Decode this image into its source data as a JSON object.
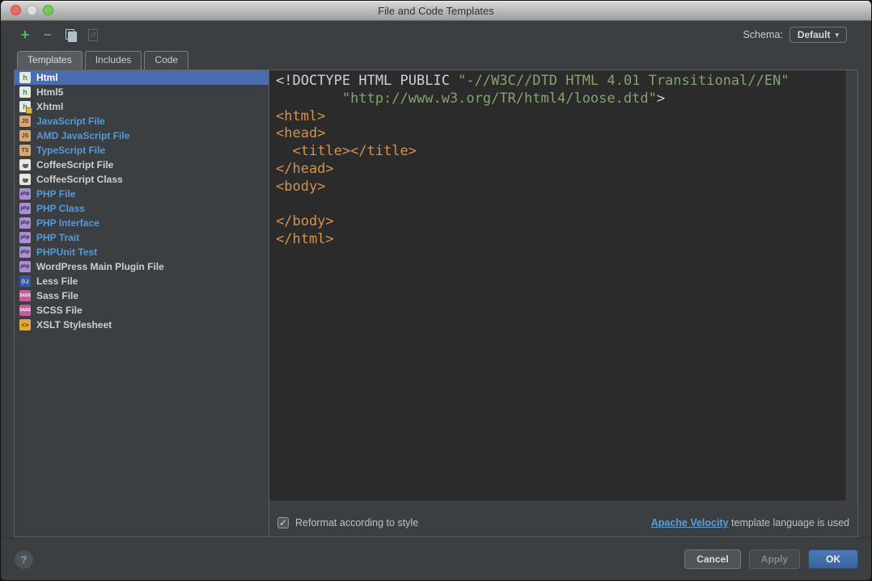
{
  "window": {
    "title": "File and Code Templates"
  },
  "titlebar_icons": {
    "close": "close-button",
    "minimize": "minimize-button",
    "zoom": "zoom-button"
  },
  "toolbar": {
    "add_glyph": "+",
    "remove_glyph": "−",
    "revert_glyph": "↺",
    "schema_label": "Schema:",
    "schema_value": "Default",
    "schema_caret": "▾"
  },
  "tabs": [
    {
      "label": "Templates",
      "selected": true
    },
    {
      "label": "Includes",
      "selected": false
    },
    {
      "label": "Code",
      "selected": false
    }
  ],
  "sidebar": {
    "items": [
      {
        "label": "Html",
        "icon": "html",
        "color": "plain",
        "selected": true
      },
      {
        "label": "Html5",
        "icon": "html",
        "color": "plain",
        "selected": false
      },
      {
        "label": "Xhtml",
        "icon": "xhtml",
        "color": "plain",
        "selected": false
      },
      {
        "label": "JavaScript File",
        "icon": "js",
        "color": "blue",
        "selected": false
      },
      {
        "label": "AMD JavaScript File",
        "icon": "js",
        "color": "blue",
        "selected": false
      },
      {
        "label": "TypeScript File",
        "icon": "ts",
        "color": "blue",
        "selected": false
      },
      {
        "label": "CoffeeScript File",
        "icon": "coffee",
        "color": "plain",
        "selected": false
      },
      {
        "label": "CoffeeScript Class",
        "icon": "coffee",
        "color": "plain",
        "selected": false
      },
      {
        "label": "PHP File",
        "icon": "php",
        "color": "blue",
        "selected": false
      },
      {
        "label": "PHP Class",
        "icon": "php",
        "color": "blue",
        "selected": false
      },
      {
        "label": "PHP Interface",
        "icon": "php",
        "color": "blue",
        "selected": false
      },
      {
        "label": "PHP Trait",
        "icon": "php",
        "color": "blue",
        "selected": false
      },
      {
        "label": "PHPUnit Test",
        "icon": "php",
        "color": "blue",
        "selected": false
      },
      {
        "label": "WordPress Main Plugin File",
        "icon": "php",
        "color": "plain",
        "selected": false
      },
      {
        "label": "Less File",
        "icon": "less",
        "color": "plain",
        "selected": false
      },
      {
        "label": "Sass File",
        "icon": "sass",
        "color": "plain",
        "selected": false
      },
      {
        "label": "SCSS File",
        "icon": "sass",
        "color": "plain",
        "selected": false
      },
      {
        "label": "XSLT Stylesheet",
        "icon": "xslt",
        "color": "plain",
        "selected": false
      }
    ]
  },
  "icon_glyphs": {
    "html": "h",
    "xhtml": "h",
    "js": "JS",
    "ts": "TS",
    "coffee": "",
    "php": "php",
    "less": "{L}",
    "sass": "SASS",
    "xslt": "<>"
  },
  "editor": {
    "lines": [
      [
        {
          "t": "<!DOCTYPE HTML PUBLIC ",
          "c": "plain"
        },
        {
          "t": "\"-//W3C//DTD HTML 4.01 Transitional//EN\"",
          "c": "str"
        }
      ],
      [
        {
          "t": "        \"http://www.w3.org/TR/html4/loose.dtd\"",
          "c": "str"
        },
        {
          "t": ">",
          "c": "plain"
        }
      ],
      [
        {
          "t": "<html>",
          "c": "tag"
        }
      ],
      [
        {
          "t": "<head>",
          "c": "tag"
        }
      ],
      [
        {
          "t": "  ",
          "c": "plain"
        },
        {
          "t": "<title></title>",
          "c": "tag"
        }
      ],
      [
        {
          "t": "</head>",
          "c": "tag"
        }
      ],
      [
        {
          "t": "<body>",
          "c": "tag"
        }
      ],
      [],
      [
        {
          "t": "</body>",
          "c": "tag"
        }
      ],
      [
        {
          "t": "</html>",
          "c": "tag"
        }
      ]
    ]
  },
  "footer": {
    "check_glyph": "✓",
    "reformat_label": "Reformat according to style",
    "checked": true,
    "velocity_link": "Apache Velocity",
    "velocity_rest": " template language is used"
  },
  "buttons": {
    "help": "?",
    "cancel": "Cancel",
    "apply": "Apply",
    "ok": "OK"
  },
  "colors": {
    "dialog_bg": "#3c3f41",
    "editor_bg": "#2b2b2b",
    "selection_blue": "#4a6daf",
    "item_blue": "#559ad8",
    "link_blue": "#5a9fd8",
    "tag_orange": "#d7914b",
    "string_green": "#85a36c",
    "ok_button_blue": "#3f6ba5"
  }
}
